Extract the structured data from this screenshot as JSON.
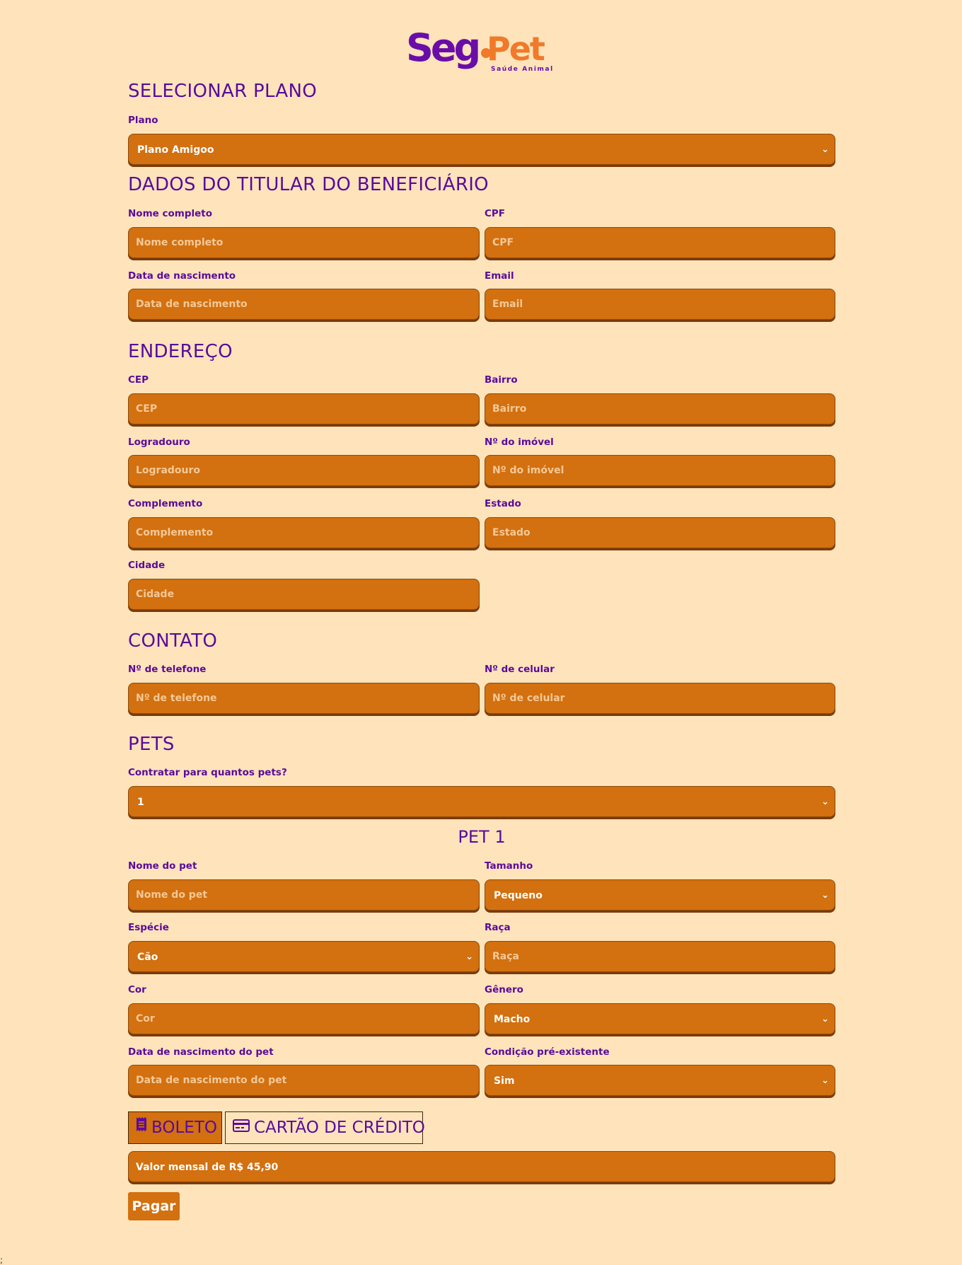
{
  "logo": {
    "seg": "Seg",
    "pet": "Pet",
    "subtitle": "Saúde Animal"
  },
  "plano": {
    "title": "SELECIONAR PLANO",
    "label": "Plano",
    "value": "Plano Amigoo"
  },
  "titular": {
    "title": "DADOS DO TITULAR DO BENEFICIÁRIO",
    "fields": [
      {
        "label": "Nome completo",
        "placeholder": "Nome completo"
      },
      {
        "label": "CPF",
        "placeholder": "CPF"
      },
      {
        "label": "Data de nascimento",
        "placeholder": "Data de nascimento"
      },
      {
        "label": "Email",
        "placeholder": "Email"
      }
    ]
  },
  "endereco": {
    "title": "ENDEREÇO",
    "fields": [
      {
        "label": "CEP",
        "placeholder": "CEP"
      },
      {
        "label": "Bairro",
        "placeholder": "Bairro"
      },
      {
        "label": "Logradouro",
        "placeholder": "Logradouro"
      },
      {
        "label": "Nº do imóvel",
        "placeholder": "Nº do imóvel"
      },
      {
        "label": "Complemento",
        "placeholder": "Complemento"
      },
      {
        "label": "Estado",
        "placeholder": "Estado"
      },
      {
        "label": "Cidade",
        "placeholder": "Cidade"
      }
    ]
  },
  "contato": {
    "title": "CONTATO",
    "fields": [
      {
        "label": "Nº de telefone",
        "placeholder": "Nº de telefone"
      },
      {
        "label": "Nº de celular",
        "placeholder": "Nº de celular"
      }
    ]
  },
  "pets": {
    "title": "PETS",
    "count_label": "Contratar para quantos pets?",
    "count_value": "1",
    "pet_title": "PET 1",
    "nome": {
      "label": "Nome do pet",
      "placeholder": "Nome do pet"
    },
    "tamanho": {
      "label": "Tamanho",
      "value": "Pequeno"
    },
    "especie": {
      "label": "Espécie",
      "value": "Cão"
    },
    "raca": {
      "label": "Raça",
      "placeholder": "Raça"
    },
    "cor": {
      "label": "Cor",
      "placeholder": "Cor"
    },
    "genero": {
      "label": "Gênero",
      "value": "Macho"
    },
    "nascimento": {
      "label": "Data de nascimento do pet",
      "placeholder": "Data de nascimento do pet"
    },
    "condicao": {
      "label": "Condição pré-existente",
      "value": "Sim"
    }
  },
  "pagamento": {
    "boleto": "BOLETO",
    "cartao": "CARTÃO DE CRÉDITO",
    "valor": "Valor mensal de R$ 45,90",
    "pagar": "Pagar"
  },
  "stray_char": ";",
  "colors": {
    "background": "#ffe4bb",
    "field": "#d3700f",
    "text": "#5a0a9c",
    "logo_orange": "#f07a2a"
  }
}
